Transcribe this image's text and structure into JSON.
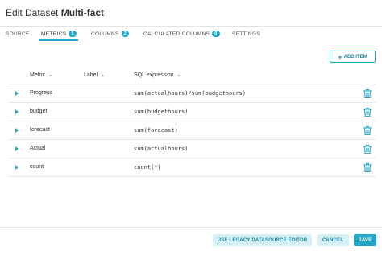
{
  "modal": {
    "title_prefix": "Edit Dataset",
    "title_name": "Multi-fact"
  },
  "tabs": [
    {
      "label": "SOURCE",
      "badge": null,
      "active": false
    },
    {
      "label": "METRICS",
      "badge": "5",
      "active": true
    },
    {
      "label": "COLUMNS",
      "badge": "2",
      "active": false
    },
    {
      "label": "CALCULATED COLUMNS",
      "badge": "0",
      "active": false
    },
    {
      "label": "SETTINGS",
      "badge": null,
      "active": false
    }
  ],
  "toolbar": {
    "add_item_label": "ADD ITEM"
  },
  "table": {
    "headers": {
      "metric": "Metric",
      "label": "Label",
      "sql": "SQL expression"
    },
    "rows": [
      {
        "metric": "Progress",
        "label": "",
        "sql": "sum(actualhours)/sum(budgethours)"
      },
      {
        "metric": "budget",
        "label": "",
        "sql": "sum(budgethours)"
      },
      {
        "metric": "forecast",
        "label": "",
        "sql": "sum(forecast)"
      },
      {
        "metric": "Actual",
        "label": "",
        "sql": "sum(actualhours)"
      },
      {
        "metric": "count",
        "label": "",
        "sql": "count(*)"
      }
    ]
  },
  "footer": {
    "legacy_label": "USE LEGACY DATASOURCE EDITOR",
    "cancel_label": "CANCEL",
    "save_label": "SAVE"
  },
  "colors": {
    "accent": "#20a7c9",
    "accent_light": "#d7f0f6",
    "text": "#323232"
  }
}
